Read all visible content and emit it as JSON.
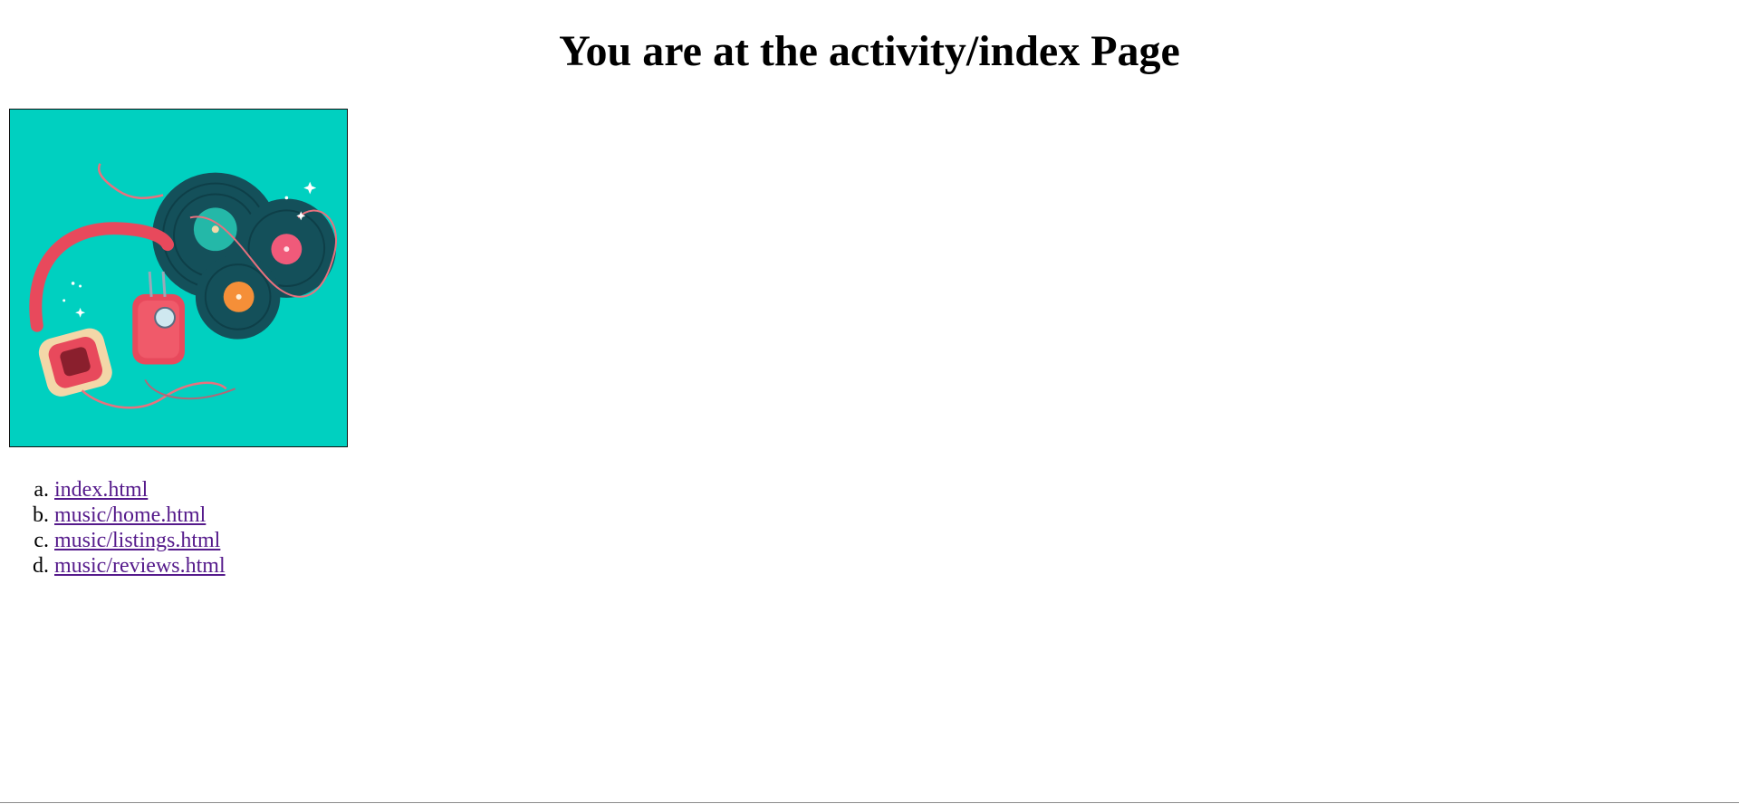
{
  "header": {
    "title": "You are at the activity/index Page"
  },
  "hero_image": {
    "description_icon": "music-headphones-vinyl-illustration",
    "background_color": "#00d0c0"
  },
  "links": [
    {
      "marker": "a",
      "label": "index.html"
    },
    {
      "marker": "b",
      "label": "music/home.html"
    },
    {
      "marker": "c",
      "label": "music/listings.html"
    },
    {
      "marker": "d",
      "label": "music/reviews.html"
    }
  ],
  "colors": {
    "link_visited": "#551a8b",
    "text": "#000000",
    "background": "#ffffff"
  }
}
